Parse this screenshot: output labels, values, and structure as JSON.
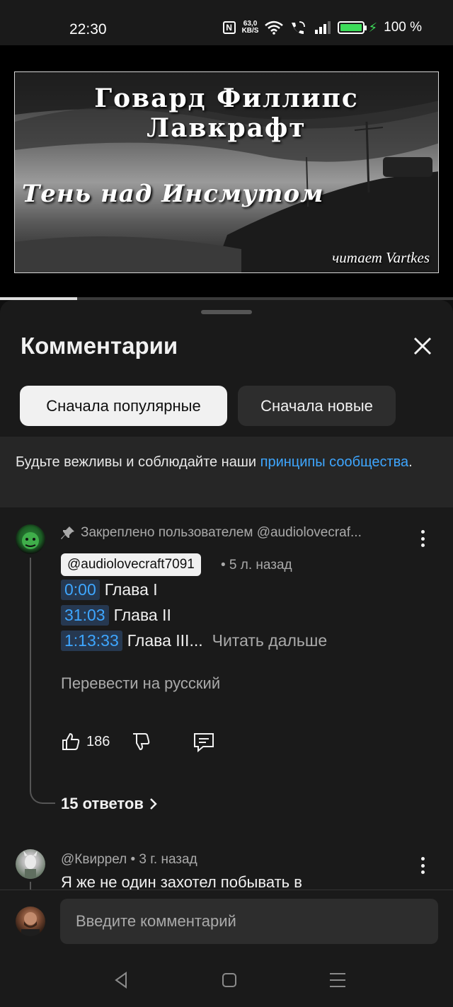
{
  "status_bar": {
    "time": "22:30",
    "speed_value": "63,0",
    "speed_unit": "KB/S",
    "battery": "100 %",
    "battery_level": 1.0,
    "icons": [
      "nfc-icon",
      "wifi-icon",
      "volte-call-icon",
      "signal-icon",
      "battery-icon",
      "charging-icon"
    ]
  },
  "video": {
    "cover_title": "Говард Филлипс Лавкрафт",
    "cover_subtitle": "Тень над Инсмутом",
    "cover_reader": "читает Vartkes",
    "progress": 0.17
  },
  "comments_sheet": {
    "title": "Комментарии",
    "close_icon": "close-icon",
    "sort_chips": [
      "Сначала популярные",
      "Сначала новые"
    ],
    "selected_sort": "Сначала популярные",
    "guideline_text": "Будьте вежливы и соблюдайте наши ",
    "guideline_link": "принципы сообщества",
    "guideline_end": "."
  },
  "pinned_comment": {
    "pinned_label": "Закреплено пользователем @audiolovecraf...",
    "author": "@audiolovecraft7091",
    "time": "• 5 л. назад",
    "chapters": [
      {
        "timestamp": "0:00",
        "title": "Глава I"
      },
      {
        "timestamp": "31:03",
        "title": "Глава II"
      },
      {
        "timestamp": "1:13:33",
        "title": "Глава III..."
      }
    ],
    "read_more": "Читать дальше",
    "translate": "Перевести на русский",
    "likes": "186",
    "replies": "15 ответов"
  },
  "second_comment": {
    "author": "@Квиррел",
    "time": "• 3 г. назад",
    "text": "Я же не один захотел побывать в"
  },
  "input": {
    "placeholder": "Введите комментарий"
  },
  "colors": {
    "background": "#0f0f0f",
    "sheet": "#1a1a1a",
    "link": "#3ea6ff",
    "battery": "#3ddc5a"
  }
}
